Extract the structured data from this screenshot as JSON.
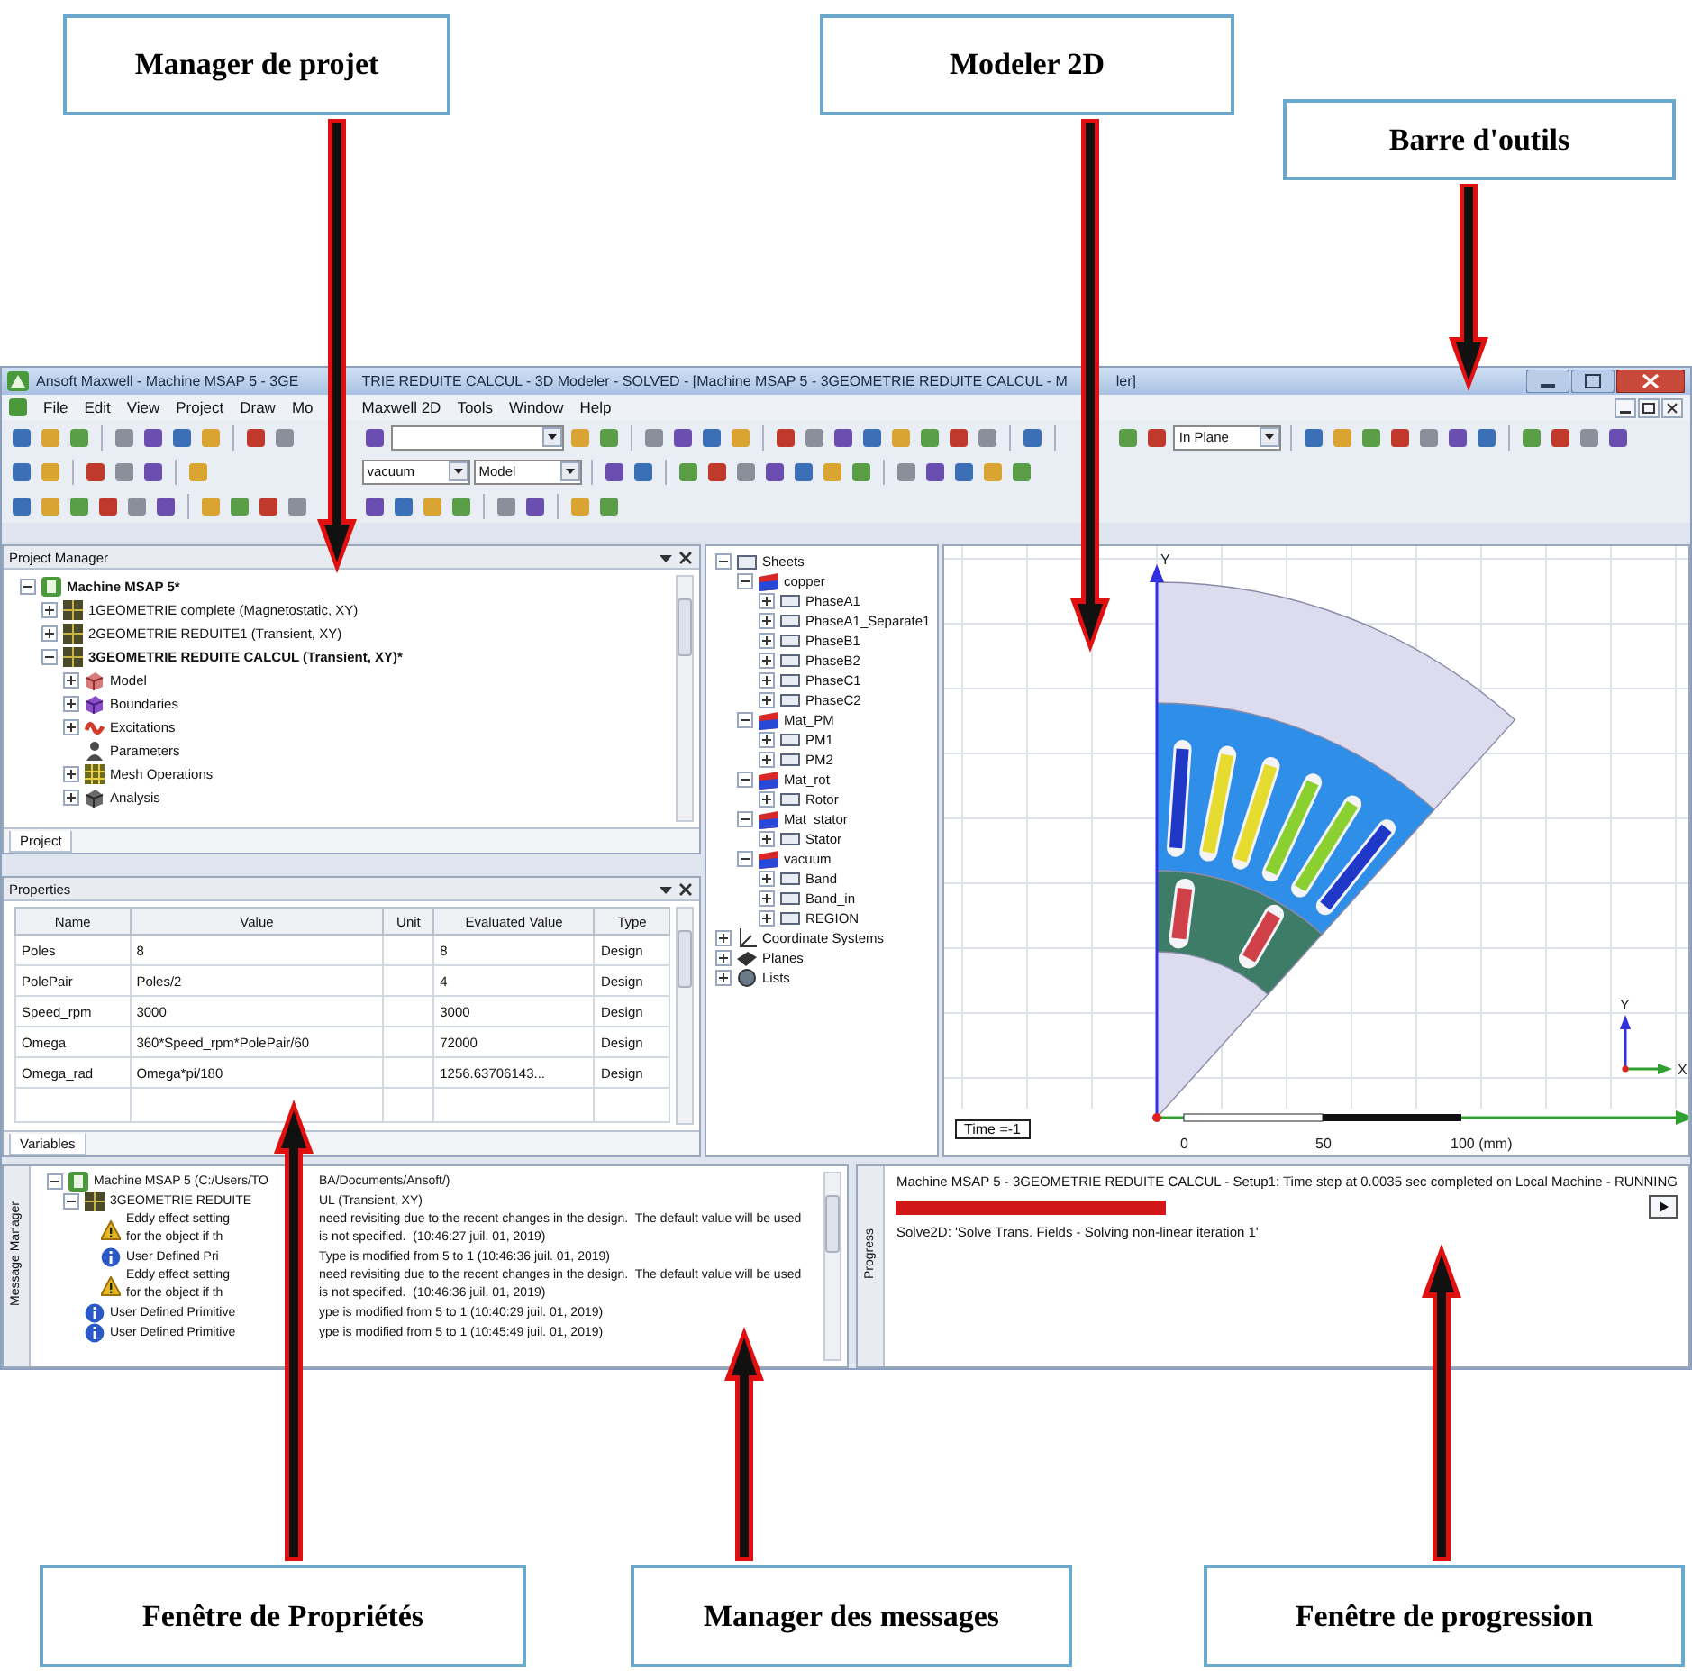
{
  "callouts": [
    {
      "label": "Manager de projet",
      "kind": "down"
    },
    {
      "label": "Modeler 2D",
      "kind": "down"
    },
    {
      "label": "Barre d'outils",
      "kind": "down"
    },
    {
      "label": "Fenêtre de Propriétés",
      "kind": "up"
    },
    {
      "label": "Manager des messages",
      "kind": "up"
    },
    {
      "label": "Fenêtre de progression",
      "kind": "up"
    }
  ],
  "window": {
    "title": [
      "Ansoft Maxwell - Machine MSAP 5 - 3GE",
      "TRIE REDUITE CALCUL - 3D Modeler - SOLVED - [Machine MSAP 5 - 3GEOMETRIE REDUITE CALCUL - M",
      "ler]"
    ]
  },
  "menu": [
    "File",
    "Edit",
    "View",
    "Project",
    "Draw",
    "Mo",
    "Maxwell 2D",
    "Tools",
    "Window",
    "Help"
  ],
  "toolbars": [
    [
      {
        "kind": "icon"
      },
      {
        "kind": "icon"
      },
      {
        "kind": "icon"
      },
      {
        "kind": "separator"
      },
      {
        "kind": "icon"
      },
      {
        "kind": "icon"
      },
      {
        "kind": "icon"
      },
      {
        "kind": "icon"
      },
      {
        "kind": "separator"
      },
      {
        "kind": "icon"
      },
      {
        "kind": "icon"
      },
      {
        "kind": "icon"
      },
      {
        "kind": "dropdown"
      },
      {
        "kind": "icon"
      },
      {
        "kind": "icon"
      },
      {
        "kind": "separator"
      },
      {
        "kind": "icon"
      },
      {
        "kind": "icon"
      },
      {
        "kind": "icon"
      },
      {
        "kind": "icon"
      },
      {
        "kind": "separator"
      },
      {
        "kind": "icon"
      },
      {
        "kind": "icon"
      },
      {
        "kind": "icon"
      },
      {
        "kind": "icon"
      },
      {
        "kind": "icon"
      },
      {
        "kind": "icon"
      },
      {
        "kind": "icon"
      },
      {
        "kind": "icon"
      },
      {
        "kind": "separator"
      },
      {
        "kind": "icon"
      },
      {
        "kind": "separator"
      },
      {
        "kind": "icon"
      },
      {
        "kind": "icon"
      },
      {
        "kind": "dropdown",
        "value": "In Plane"
      },
      {
        "kind": "separator"
      },
      {
        "kind": "icon"
      },
      {
        "kind": "icon"
      },
      {
        "kind": "icon"
      },
      {
        "kind": "icon"
      },
      {
        "kind": "icon"
      },
      {
        "kind": "icon"
      },
      {
        "kind": "icon"
      },
      {
        "kind": "separator"
      },
      {
        "kind": "icon"
      },
      {
        "kind": "icon"
      },
      {
        "kind": "icon"
      },
      {
        "kind": "icon"
      }
    ],
    [
      {
        "kind": "icon"
      },
      {
        "kind": "icon"
      },
      {
        "kind": "separator"
      },
      {
        "kind": "icon"
      },
      {
        "kind": "icon"
      },
      {
        "kind": "icon"
      },
      {
        "kind": "separator"
      },
      {
        "kind": "icon"
      },
      {
        "kind": "dropdown",
        "value": "vacuum"
      },
      {
        "kind": "dropdown",
        "value": "Model"
      },
      {
        "kind": "separator"
      },
      {
        "kind": "icon"
      },
      {
        "kind": "icon"
      },
      {
        "kind": "separator"
      },
      {
        "kind": "icon"
      },
      {
        "kind": "icon"
      },
      {
        "kind": "icon"
      },
      {
        "kind": "icon"
      },
      {
        "kind": "icon"
      },
      {
        "kind": "icon"
      },
      {
        "kind": "icon"
      },
      {
        "kind": "separator"
      },
      {
        "kind": "icon"
      },
      {
        "kind": "icon"
      },
      {
        "kind": "icon"
      },
      {
        "kind": "icon"
      },
      {
        "kind": "icon"
      }
    ],
    [
      {
        "kind": "icon"
      },
      {
        "kind": "icon"
      },
      {
        "kind": "icon"
      },
      {
        "kind": "icon"
      },
      {
        "kind": "icon"
      },
      {
        "kind": "icon"
      },
      {
        "kind": "separator"
      },
      {
        "kind": "icon"
      },
      {
        "kind": "icon"
      },
      {
        "kind": "icon"
      },
      {
        "kind": "icon"
      },
      {
        "kind": "icon"
      },
      {
        "kind": "icon"
      },
      {
        "kind": "icon"
      },
      {
        "kind": "icon"
      },
      {
        "kind": "separator"
      },
      {
        "kind": "icon"
      },
      {
        "kind": "icon"
      },
      {
        "kind": "separator"
      },
      {
        "kind": "icon"
      },
      {
        "kind": "icon"
      }
    ]
  ],
  "project_manager": {
    "title": "Project Manager",
    "tabs": [
      {
        "label": "Project",
        "selected": true
      }
    ],
    "tree": [
      {
        "label": "Machine MSAP 5*",
        "kind": "project",
        "active": true,
        "expanded": true,
        "children": [
          {
            "label": "1GEOMETRIE complete (Magnetostatic, XY)",
            "kind": "design",
            "active": false,
            "expanded": false
          },
          {
            "label": "2GEOMETRIE REDUITE1 (Transient, XY)",
            "kind": "design",
            "active": false,
            "expanded": false
          },
          {
            "label": "3GEOMETRIE REDUITE CALCUL (Transient, XY)*",
            "kind": "design",
            "active": true,
            "expanded": true,
            "children": [
              {
                "label": "Model",
                "kind": "model",
                "expanded": false
              },
              {
                "label": "Boundaries",
                "kind": "boundaries",
                "expanded": false
              },
              {
                "label": "Excitations",
                "kind": "excitations",
                "expanded": false
              },
              {
                "label": "Parameters",
                "kind": "parameters"
              },
              {
                "label": "Mesh Operations",
                "kind": "mesh",
                "expanded": false
              },
              {
                "label": "Analysis",
                "kind": "analysis",
                "expanded": false
              }
            ]
          }
        ]
      }
    ]
  },
  "properties": {
    "title": "Properties",
    "tabs": [
      {
        "label": "Variables",
        "selected": true
      }
    ],
    "columns": [
      "Name",
      "Value",
      "Unit",
      "Evaluated Value",
      "Type"
    ],
    "rows": [
      [
        "Poles",
        "8",
        "",
        "8",
        "Design"
      ],
      [
        "PolePair",
        "Poles/2",
        "",
        "4",
        "Design"
      ],
      [
        "Speed_rpm",
        "3000",
        "",
        "3000",
        "Design"
      ],
      [
        "Omega",
        "360*Speed_rpm*PolePair/60",
        "",
        "72000",
        "Design"
      ],
      [
        "Omega_rad",
        "Omega*pi/180",
        "",
        "1256.63706143...",
        "Design"
      ]
    ]
  },
  "model_tree": [
    {
      "label": "Sheets",
      "kind": "folder",
      "expanded": true,
      "children": [
        {
          "label": "copper",
          "kind": "material",
          "expanded": true,
          "children": [
            {
              "label": "PhaseA1",
              "kind": "sheet",
              "expanded": false
            },
            {
              "label": "PhaseA1_Separate1",
              "kind": "sheet",
              "expanded": false
            },
            {
              "label": "PhaseB1",
              "kind": "sheet",
              "expanded": false
            },
            {
              "label": "PhaseB2",
              "kind": "sheet",
              "expanded": false
            },
            {
              "label": "PhaseC1",
              "kind": "sheet",
              "expanded": false
            },
            {
              "label": "PhaseC2",
              "kind": "sheet",
              "expanded": false
            }
          ]
        },
        {
          "label": "Mat_PM",
          "kind": "material",
          "expanded": true,
          "children": [
            {
              "label": "PM1",
              "kind": "sheet",
              "expanded": false
            },
            {
              "label": "PM2",
              "kind": "sheet",
              "expanded": false
            }
          ]
        },
        {
          "label": "Mat_rot",
          "kind": "material",
          "expanded": true,
          "children": [
            {
              "label": "Rotor",
              "kind": "sheet",
              "expanded": false
            }
          ]
        },
        {
          "label": "Mat_stator",
          "kind": "material",
          "expanded": true,
          "children": [
            {
              "label": "Stator",
              "kind": "sheet",
              "expanded": false
            }
          ]
        },
        {
          "label": "vacuum",
          "kind": "material",
          "expanded": true,
          "children": [
            {
              "label": "Band",
              "kind": "sheet",
              "expanded": false
            },
            {
              "label": "Band_in",
              "kind": "sheet",
              "expanded": false
            },
            {
              "label": "REGION",
              "kind": "sheet",
              "expanded": false
            }
          ]
        }
      ]
    },
    {
      "label": "Coordinate Systems",
      "kind": "coordinates",
      "expanded": false
    },
    {
      "label": "Planes",
      "kind": "planes",
      "expanded": false
    },
    {
      "label": "Lists",
      "kind": "lists",
      "expanded": false
    }
  ],
  "modeler": {
    "time_label": "Time =-1",
    "axis_labels": [
      "Y",
      "Y",
      "X"
    ],
    "scale_labels": [
      "0",
      "50",
      "100 (mm)"
    ]
  },
  "messages": {
    "side_label": "Message Manager",
    "tree": [
      {
        "lines": [
          [
            "Machine MSAP 5 (C:/Users/TO",
            "BA/Documents/Ansoft/)"
          ]
        ],
        "kind": "project",
        "expanded": true,
        "children": [
          {
            "lines": [
              [
                "3GEOMETRIE REDUITE",
                "UL (Transient, XY)"
              ]
            ],
            "kind": "design",
            "expanded": true,
            "children": [
              {
                "lines": [
                  [
                    "Eddy effect setting",
                    "need revisiting due to the recent changes in the design.  The default value will be used"
                  ],
                  [
                    "for the object if th",
                    "is not specified.  (10:46:27 juil. 01, 2019)"
                  ]
                ],
                "kind": "warning"
              },
              {
                "lines": [
                  [
                    "User Defined Pri",
                    "Type is modified from 5 to 1 (10:46:36 juil. 01, 2019)"
                  ]
                ],
                "kind": "info"
              },
              {
                "lines": [
                  [
                    "Eddy effect setting",
                    "need revisiting due to the recent changes in the design.  The default value will be used"
                  ],
                  [
                    "for the object if th",
                    "is not specified.  (10:46:36 juil. 01, 2019)"
                  ]
                ],
                "kind": "warning"
              }
            ]
          },
          {
            "lines": [
              [
                "User Defined Primitive",
                "ype is modified from 5 to 1 (10:40:29 juil. 01, 2019)"
              ]
            ],
            "kind": "info"
          },
          {
            "lines": [
              [
                "User Defined Primitive",
                "ype is modified from 5 to 1 (10:45:49 juil. 01, 2019)"
              ]
            ],
            "kind": "info"
          }
        ]
      }
    ]
  },
  "progress": {
    "side_label": "Progress",
    "task": "Machine MSAP 5 - 3GEOMETRIE REDUITE CALCUL - Setup1: Time step at 0.0035 sec completed on Local Machine - RUNNING",
    "detail": "Solve2D: 'Solve Trans. Fields - Solving non-linear iteration 1'"
  }
}
